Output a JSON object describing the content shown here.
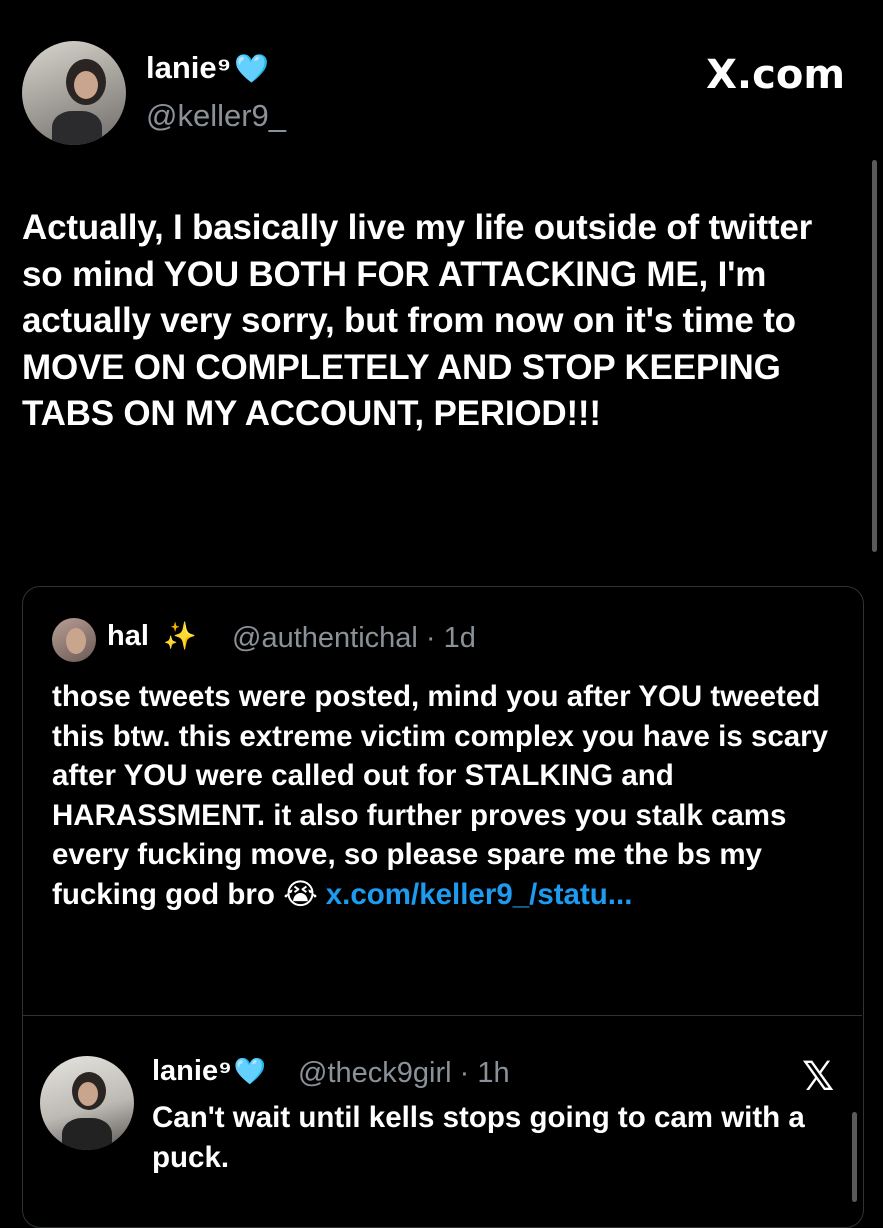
{
  "main_post": {
    "display_name": "lanie⁹",
    "heart": "🩵",
    "handle": "@keller9_",
    "site": "X.com",
    "text": "Actually, I basically live my life outside of twitter so mind YOU BOTH FOR ATTACKING ME, I'm actually very  sorry, but from now on it's time to MOVE ON COMPLETELY AND STOP KEEPING TABS ON MY ACCOUNT, PERIOD!!!"
  },
  "quoted_post": {
    "display_name": "hal",
    "sparkles": "✨",
    "handle_time": "@authentichal · 1d",
    "text": "those tweets were posted, mind you after YOU tweeted this btw. this extreme victim complex you have is scary after YOU were called out for STALKING and HARASSMENT. it also further proves you stalk cams every fucking move, so please spare me the bs my fucking god bro",
    "emoji": "😭",
    "link": "x.com/keller9_/statu..."
  },
  "nested_post": {
    "display_name": "lanie⁹",
    "heart": "🩵",
    "handle_time": "@theck9girl · 1h",
    "x_icon": "𝕏",
    "text": "Can't wait until kells stops going to cam with a puck."
  }
}
